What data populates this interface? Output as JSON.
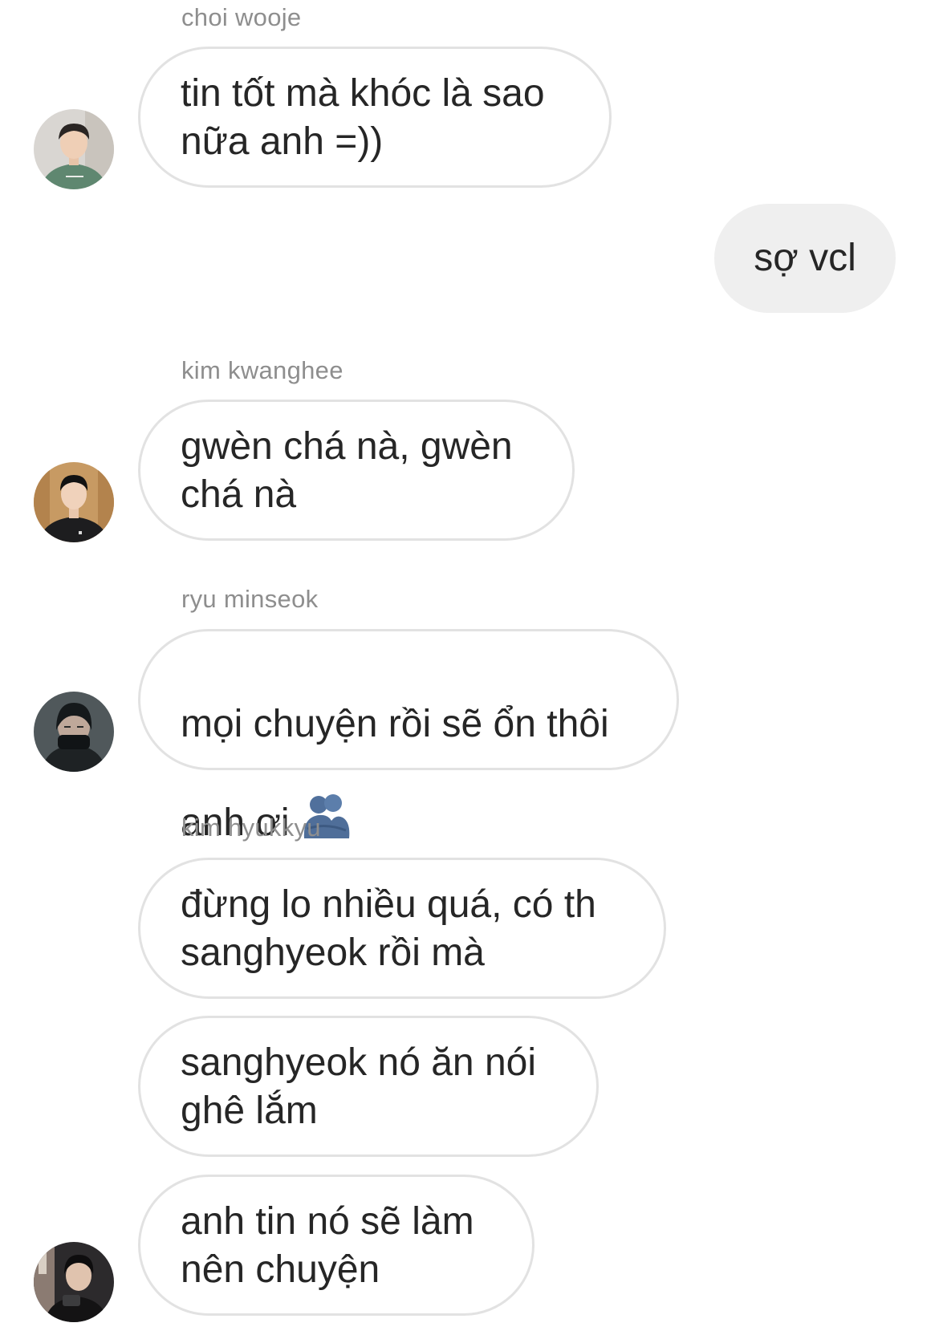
{
  "messages": [
    {
      "sender": "choi wooje",
      "text": "tin tốt mà khóc là sao\nnữa anh =))"
    },
    {
      "own": true,
      "text": "sợ vcl"
    },
    {
      "sender": "kim kwanghee",
      "text": "gwèn chá nà, gwèn\nchá nà"
    },
    {
      "sender": "ryu minseok",
      "text_line1": "mọi chuyện rồi sẽ ổn thôi",
      "text_line2": "anh ơi",
      "emoji": "people-hugging-icon"
    },
    {
      "sender": "kim hyukkyu",
      "bubbles": [
        "đừng lo nhiều quá, có th\nsanghyeok rồi mà",
        "sanghyeok nó ăn nói\nghê lắm",
        "anh tin nó sẽ làm\nnên chuyện"
      ]
    }
  ],
  "colors": {
    "bubble_border": "#e2e2e2",
    "own_bubble_bg": "#efefef",
    "text": "#262626",
    "sender_name": "#8e8e8e",
    "emoji_blue": "#4e6d99"
  }
}
